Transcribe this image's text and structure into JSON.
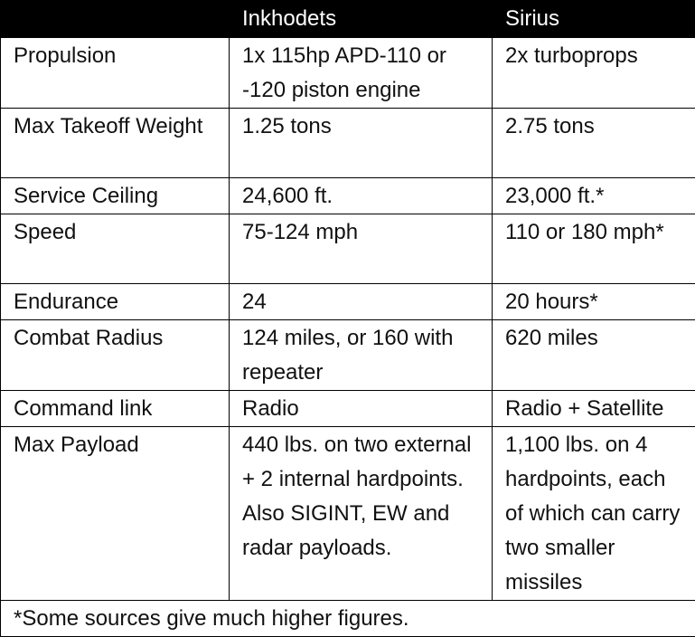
{
  "table": {
    "headers": [
      "",
      "Inkhodets",
      "Sirius"
    ],
    "rows": [
      {
        "label": "Propulsion",
        "inkhodets": "1x 115hp APD-110 or -120 piston engine",
        "sirius": "2x turboprops"
      },
      {
        "label": "Max Takeoff Weight",
        "inkhodets": "1.25 tons",
        "sirius": "2.75 tons"
      },
      {
        "label": "Service Ceiling",
        "inkhodets": "24,600 ft.",
        "sirius": "23,000 ft.*"
      },
      {
        "label": "Speed",
        "inkhodets": "75-124 mph",
        "sirius": "110 or 180 mph*"
      },
      {
        "label": "Endurance",
        "inkhodets": "24",
        "sirius": "20 hours*"
      },
      {
        "label": "Combat Radius",
        "inkhodets": "124 miles, or 160 with repeater",
        "sirius": "620 miles"
      },
      {
        "label": "Command link",
        "inkhodets": "Radio",
        "sirius": "Radio + Satellite"
      },
      {
        "label": "Max Payload",
        "inkhodets": "440 lbs. on two external + 2 internal hardpoints. Also SIGINT, EW and radar payloads.",
        "sirius": "1,100 lbs. on 4 hardpoints, each of which can carry two smaller missiles"
      }
    ],
    "footnote": "*Some sources give much higher figures."
  }
}
